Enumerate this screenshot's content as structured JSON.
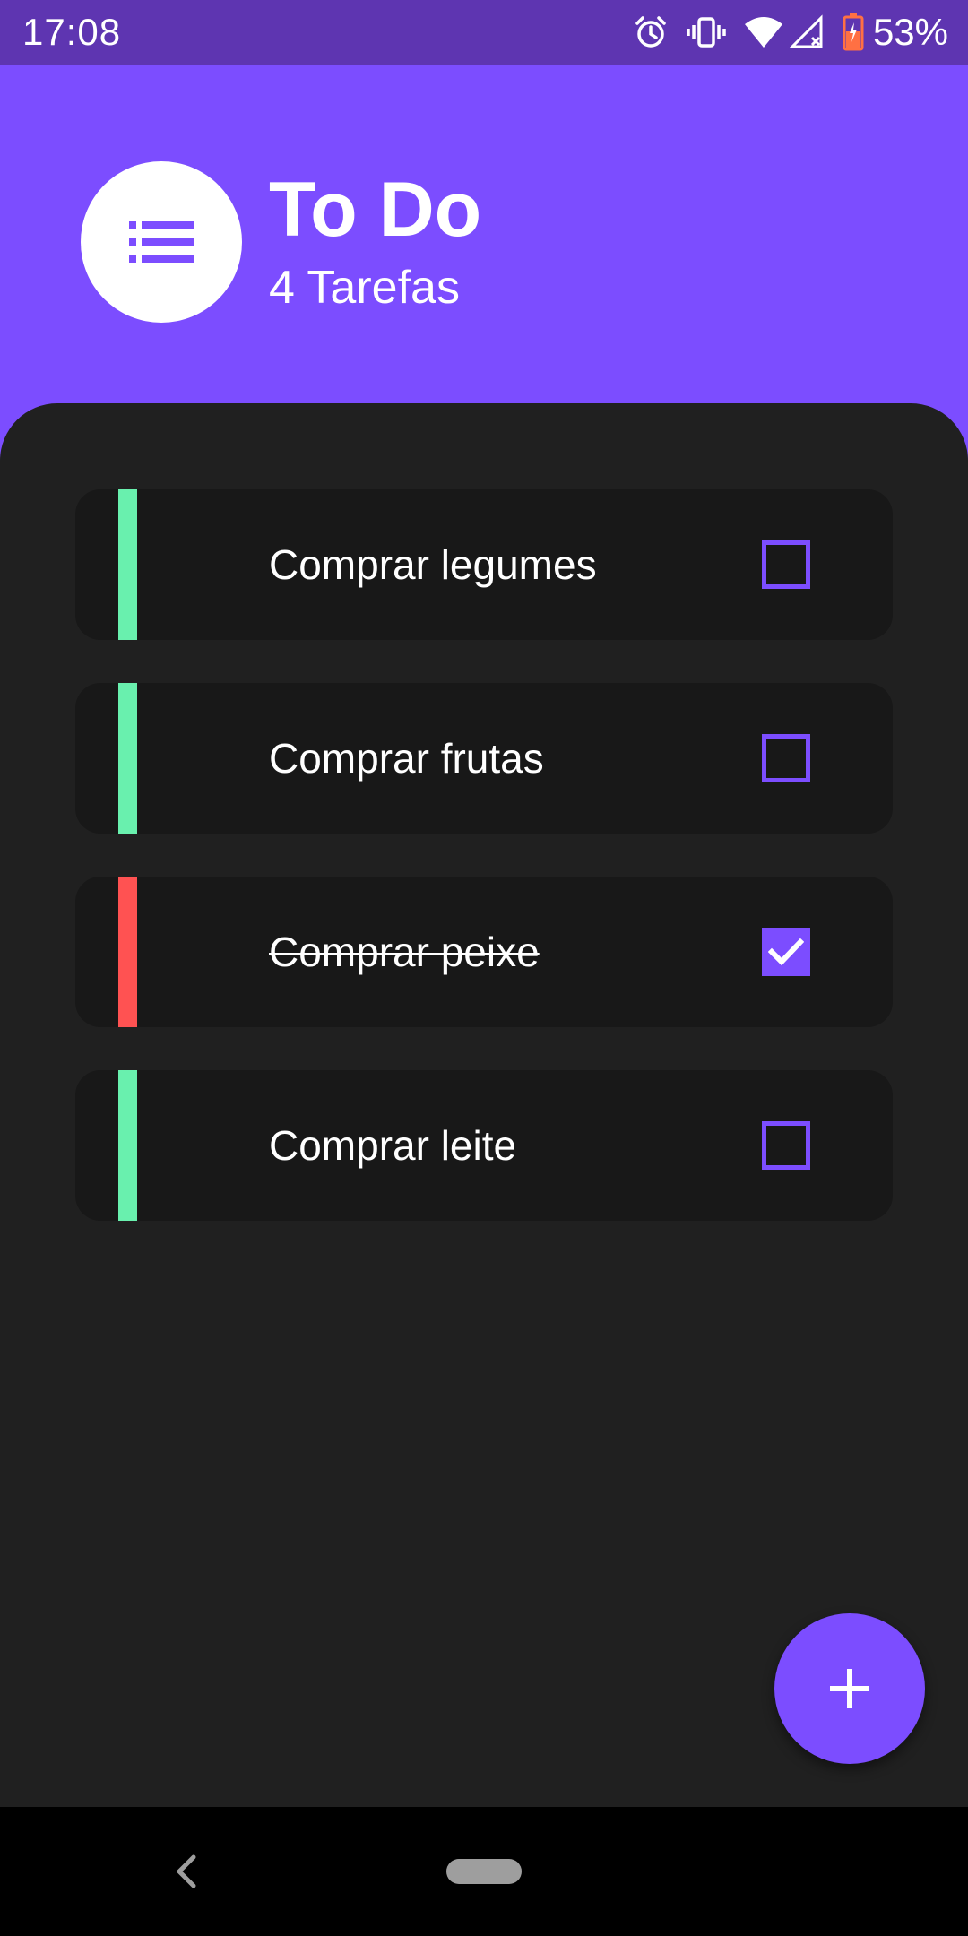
{
  "status_bar": {
    "time": "17:08",
    "battery_percent": "53%",
    "icons": [
      "alarm-icon",
      "vibrate-icon",
      "wifi-icon",
      "signal-no-service-icon",
      "battery-charging-icon"
    ]
  },
  "header": {
    "title": "To Do",
    "subtitle": "4 Tarefas",
    "avatar_icon": "list-icon"
  },
  "tasks": [
    {
      "label": "Comprar legumes",
      "done": false,
      "accent": "#69f0ae"
    },
    {
      "label": "Comprar frutas",
      "done": false,
      "accent": "#69f0ae"
    },
    {
      "label": "Comprar peixe",
      "done": true,
      "accent": "#ff5252"
    },
    {
      "label": "Comprar leite",
      "done": false,
      "accent": "#69f0ae"
    }
  ],
  "fab": {
    "icon": "plus-icon"
  },
  "nav": {
    "back_icon": "back-icon",
    "home_icon": "home-pill-icon"
  },
  "colors": {
    "primary": "#7c4dff",
    "status_bar": "#5e35b1",
    "background": "#202020",
    "card": "#181818",
    "pending_accent": "#69f0ae",
    "done_accent": "#ff5252"
  }
}
